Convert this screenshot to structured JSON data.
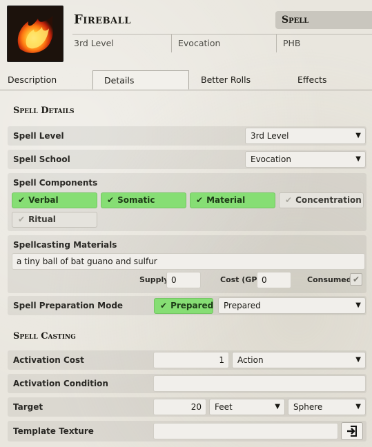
{
  "item": {
    "name": "Fireball",
    "type": "Spell",
    "level": "3rd Level",
    "school": "Evocation",
    "source": "PHB",
    "portrait_icon": "fireball-flame-icon"
  },
  "tabs": [
    "Description",
    "Details",
    "Better Rolls",
    "Effects"
  ],
  "active_tab": "Details",
  "spell_details": {
    "section_title": "Spell Details",
    "spell_level_label": "Spell Level",
    "spell_level_value": "3rd Level",
    "spell_school_label": "Spell School",
    "spell_school_value": "Evocation",
    "components_label": "Spell Components",
    "components": [
      {
        "label": "Verbal",
        "checked": true
      },
      {
        "label": "Somatic",
        "checked": true
      },
      {
        "label": "Material",
        "checked": true
      },
      {
        "label": "Concentration",
        "checked": false
      },
      {
        "label": "Ritual",
        "checked": false
      }
    ],
    "materials_label": "Spellcasting Materials",
    "materials_value": "a tiny ball of bat guano and sulfur",
    "supply_label": "Supply",
    "supply_value": "0",
    "cost_label": "Cost (GP)",
    "cost_value": "0",
    "consumed_label": "Consumed",
    "consumed_checked": true,
    "prep_mode_label": "Spell Preparation Mode",
    "prepared_toggle_label": "Prepared",
    "prep_mode_value": "Prepared"
  },
  "spell_casting": {
    "section_title": "Spell Casting",
    "activation_cost_label": "Activation Cost",
    "activation_cost_value": "1",
    "activation_type": "Action",
    "activation_condition_label": "Activation Condition",
    "activation_condition_value": "",
    "target_label": "Target",
    "target_value": "20",
    "target_units": "Feet",
    "target_type": "Sphere",
    "template_texture_label": "Template Texture",
    "template_texture_value": ""
  },
  "colors": {
    "accent_green": "#86de74",
    "background": "#e9e6de"
  },
  "icons": {
    "check": "check-icon",
    "caret": "chevron-down-icon",
    "file_picker": "file-import-icon"
  }
}
